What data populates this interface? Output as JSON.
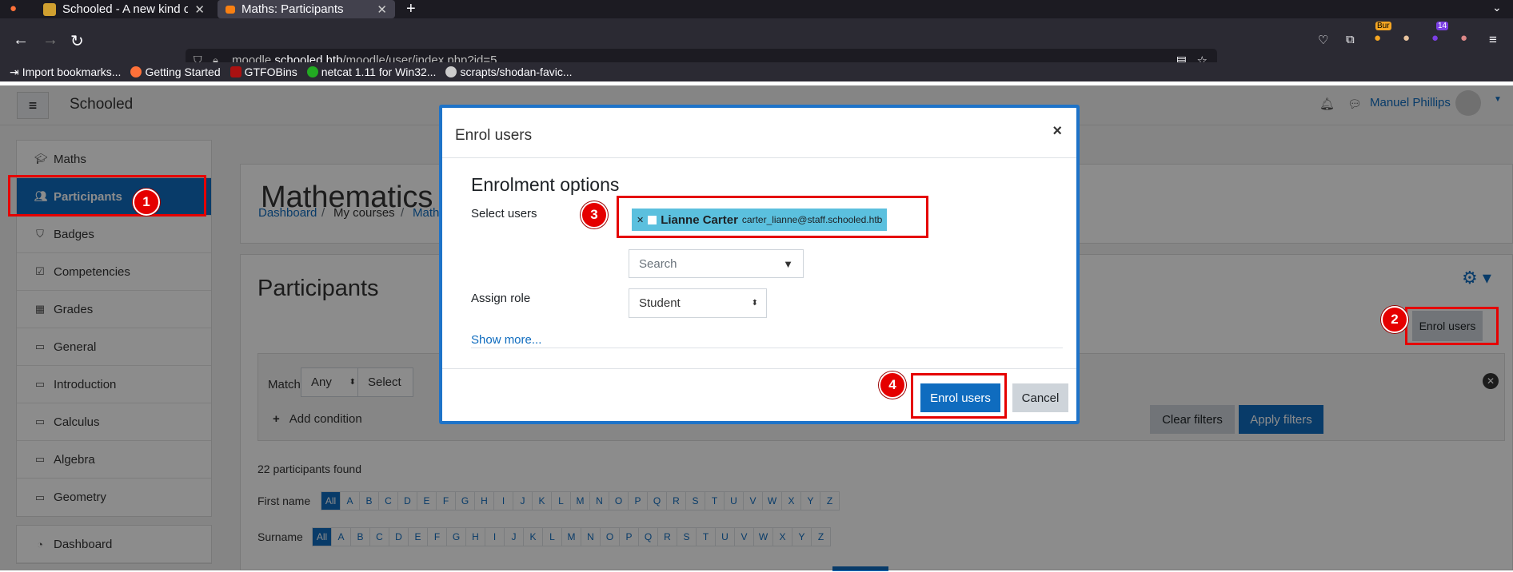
{
  "browser": {
    "tabs": [
      {
        "title": "Schooled - A new kind of e"
      },
      {
        "title": "Maths: Participants"
      }
    ],
    "url_prefix": "moodle.",
    "url_domain": "schooled.htb",
    "url_path": "/moodle/user/index.php?id=5",
    "bookmarks": [
      "Import bookmarks...",
      "Getting Started",
      "GTFOBins",
      "netcat 1.11 for Win32...",
      "scrapts/shodan-favic..."
    ],
    "ext_badges": [
      "Bur",
      "14"
    ]
  },
  "moodle": {
    "site_name": "Schooled",
    "user_name": "Manuel Phillips",
    "sidebar": [
      {
        "label": "Maths",
        "icon": "graduation-cap-icon"
      },
      {
        "label": "Participants",
        "icon": "users-icon"
      },
      {
        "label": "Badges",
        "icon": "shield-icon"
      },
      {
        "label": "Competencies",
        "icon": "check-square-icon"
      },
      {
        "label": "Grades",
        "icon": "table-icon"
      },
      {
        "label": "General",
        "icon": "folder-icon"
      },
      {
        "label": "Introduction",
        "icon": "folder-icon"
      },
      {
        "label": "Calculus",
        "icon": "folder-icon"
      },
      {
        "label": "Algebra",
        "icon": "folder-icon"
      },
      {
        "label": "Geometry",
        "icon": "folder-icon"
      }
    ],
    "dashboard_label": "Dashboard",
    "course_title": "Mathematics",
    "breadcrumb": [
      "Dashboard",
      "My courses",
      "Math"
    ],
    "participants_heading": "Participants",
    "enrol_users_btn": "Enrol users",
    "match_label": "Match",
    "match_value": "Any",
    "select_label": "Select",
    "add_condition": "Add condition",
    "clear_filters": "Clear filters",
    "apply_filters": "Apply filters",
    "found_text": "22 participants found",
    "firstname_label": "First name",
    "surname_label": "Surname",
    "all_label": "All",
    "letters": [
      "A",
      "B",
      "C",
      "D",
      "E",
      "F",
      "G",
      "H",
      "I",
      "J",
      "K",
      "L",
      "M",
      "N",
      "O",
      "P",
      "Q",
      "R",
      "S",
      "T",
      "U",
      "V",
      "W",
      "X",
      "Y",
      "Z"
    ]
  },
  "modal": {
    "title": "Enrol users",
    "section": "Enrolment options",
    "select_users_label": "Select users",
    "selected_user_name": "Lianne Carter",
    "selected_user_email": "carter_lianne@staff.schooled.htb",
    "search_placeholder": "Search",
    "assign_role_label": "Assign role",
    "role_value": "Student",
    "show_more": "Show more...",
    "submit": "Enrol users",
    "cancel": "Cancel"
  },
  "annotations": [
    "1",
    "2",
    "3",
    "4"
  ],
  "colors": {
    "accent": "#0f6cbf",
    "annotation": "#e50000",
    "chip": "#5bc0de"
  }
}
